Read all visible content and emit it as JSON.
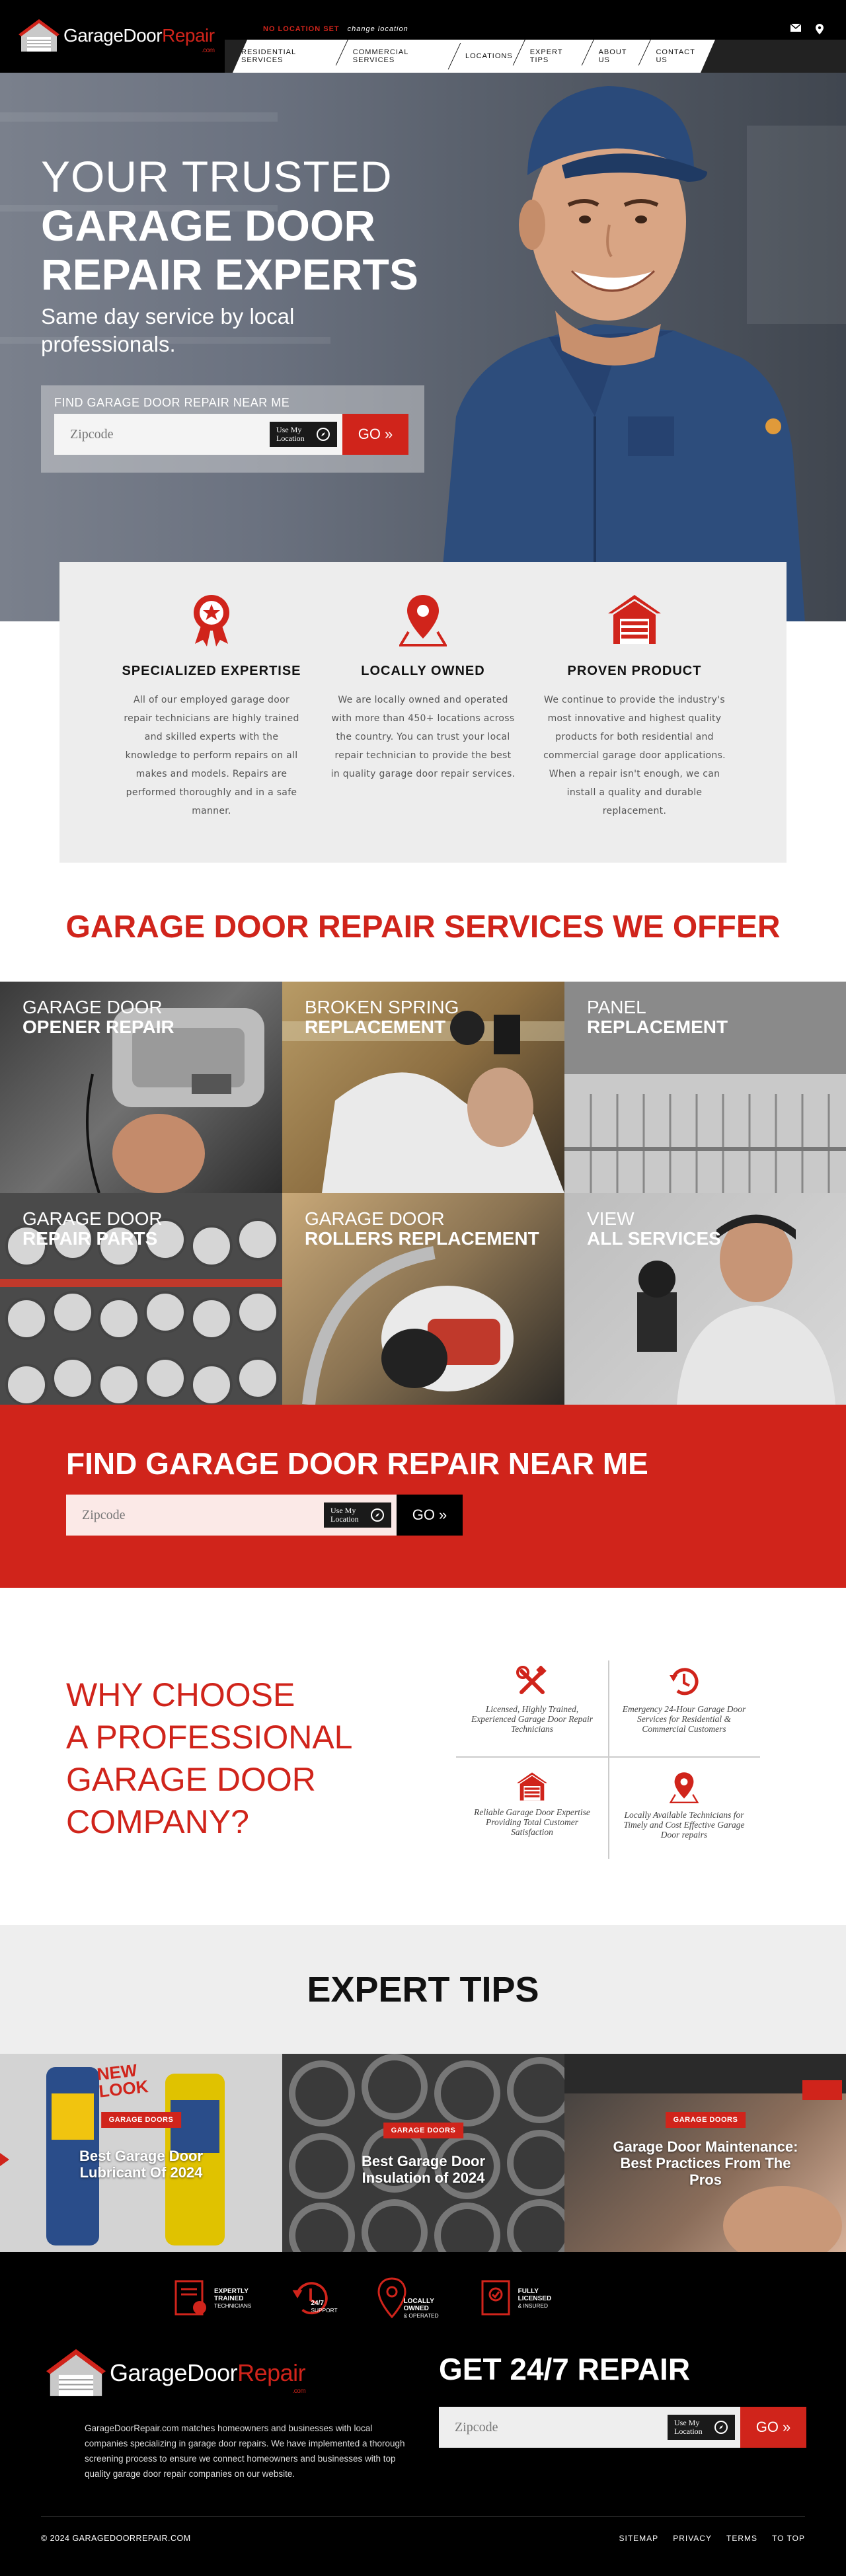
{
  "header": {
    "logo": {
      "main": "GarageDoor",
      "accent": "Repair",
      "suffix": ".com"
    },
    "location_status": "NO LOCATION SET",
    "change_location": "change location",
    "nav": [
      "RESIDENTIAL SERVICES",
      "COMMERCIAL SERVICES",
      "LOCATIONS",
      "EXPERT TIPS",
      "ABOUT US",
      "CONTACT US"
    ],
    "icons": [
      "mail-icon",
      "location-pin-icon"
    ]
  },
  "hero": {
    "line1": "YOUR TRUSTED",
    "line2": "GARAGE DOOR",
    "line3": "REPAIR EXPERTS",
    "subtitle": "Same day service by local professionals.",
    "find_label": "FIND GARAGE DOOR REPAIR NEAR ME",
    "zip_placeholder": "Zipcode",
    "use_location": "Use My Location",
    "go": "GO »"
  },
  "features": [
    {
      "icon": "award-ribbon-icon",
      "title": "SPECIALIZED EXPERTISE",
      "text": "All of our employed garage door repair technicians are highly trained and skilled experts with the knowledge to perform repairs on all makes and models. Repairs are performed thoroughly and in a safe manner."
    },
    {
      "icon": "location-pin-icon",
      "title": "LOCALLY OWNED",
      "text": "We are locally owned and operated with more than 450+ locations across the country. You can trust your local repair technician to provide the best in quality garage door repair services."
    },
    {
      "icon": "garage-icon",
      "title": "PROVEN PRODUCT",
      "text": "We continue to provide the industry's most innovative and highest quality products for both residential and commercial garage door applications. When a repair isn't enough, we can install a quality and durable replacement."
    }
  ],
  "services": {
    "title": "GARAGE DOOR REPAIR SERVICES WE OFFER",
    "tiles": [
      {
        "top": "GARAGE DOOR",
        "bottom": "OPENER REPAIR"
      },
      {
        "top": "BROKEN SPRING",
        "bottom": "REPLACEMENT"
      },
      {
        "top": "PANEL",
        "bottom": "REPLACEMENT"
      },
      {
        "top": "GARAGE DOOR",
        "bottom": "REPAIR PARTS"
      },
      {
        "top": "GARAGE DOOR",
        "bottom": "ROLLERS REPLACEMENT"
      },
      {
        "top": "VIEW",
        "bottom": "ALL SERVICES"
      }
    ]
  },
  "find_near": {
    "title": "FIND GARAGE DOOR REPAIR NEAR ME",
    "zip_placeholder": "Zipcode",
    "use_location": "Use My Location",
    "go": "GO »"
  },
  "why": {
    "title_lines": [
      "WHY CHOOSE",
      "A PROFESSIONAL",
      "GARAGE DOOR",
      "COMPANY?"
    ],
    "items": [
      {
        "icon": "tools-icon",
        "text": "Licensed, Highly Trained, Experienced Garage Door Repair Technicians"
      },
      {
        "icon": "clock-icon",
        "text": "Emergency 24-Hour Garage Door Services for Residential & Commercial Customers"
      },
      {
        "icon": "garage-icon",
        "text": "Reliable Garage Door Expertise Providing Total Customer Satisfaction"
      },
      {
        "icon": "location-pin-icon",
        "text": "Locally Available Technicians for Timely and Cost Effective Garage Door repairs"
      }
    ]
  },
  "tips": {
    "title": "EXPERT TIPS",
    "items": [
      {
        "tag": "GARAGE DOORS",
        "title": "Best Garage Door Lubricant Of 2024",
        "sticker_line1": "NEW",
        "sticker_line2": "LOOK"
      },
      {
        "tag": "GARAGE DOORS",
        "title": "Best Garage Door Insulation of 2024"
      },
      {
        "tag": "GARAGE DOORS",
        "title": "Garage Door Maintenance: Best Practices From The Pros"
      }
    ]
  },
  "footer": {
    "badges": [
      {
        "icon": "certificate-icon",
        "line1": "EXPERTLY",
        "line2": "TRAINED",
        "line3": "TECHNICIANS"
      },
      {
        "icon": "clock-icon",
        "line1": "24/7",
        "line2": "SUPPORT",
        "line3": ""
      },
      {
        "icon": "location-pin-icon",
        "line1": "LOCALLY",
        "line2": "OWNED",
        "line3": "& OPERATED"
      },
      {
        "icon": "license-icon",
        "line1": "FULLY",
        "line2": "LICENSED",
        "line3": "& INSURED"
      }
    ],
    "description": "GarageDoorRepair.com matches homeowners and businesses with local companies specializing in garage door repairs. We have implemented a thorough screening process to ensure we connect homeowners and businesses with top quality garage door repair companies on our website.",
    "cta": "GET 24/7 REPAIR",
    "zip_placeholder": "Zipcode",
    "use_location": "Use My Location",
    "go": "GO »",
    "copyright": "© 2024 GARAGEDOORREPAIR.COM",
    "links": [
      "SITEMAP",
      "PRIVACY",
      "TERMS",
      "TO TOP"
    ]
  },
  "colors": {
    "accent": "#d0241b",
    "dark": "#000000",
    "light_panel": "#ededed"
  }
}
